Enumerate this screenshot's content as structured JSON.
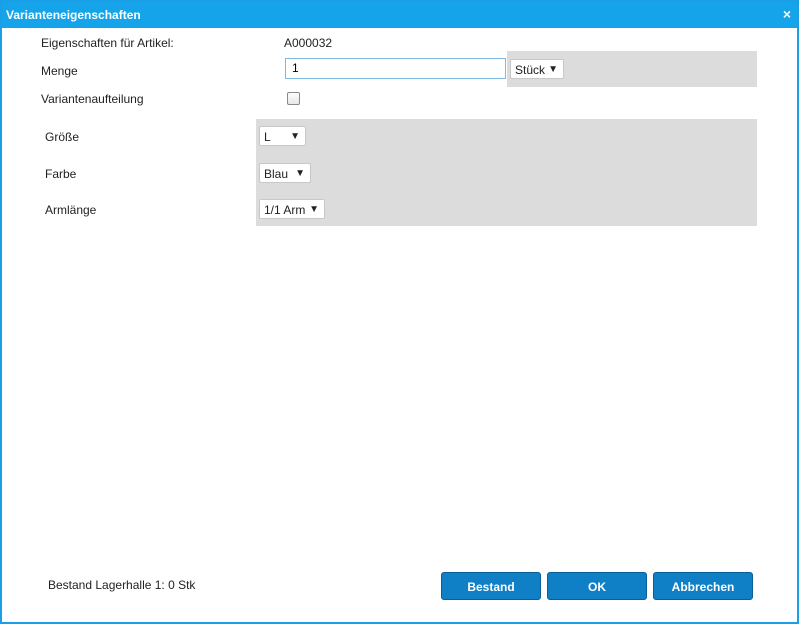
{
  "window": {
    "title": "Varianteneigenschaften",
    "close_symbol": "×"
  },
  "article": {
    "label": "Eigenschaften für Artikel:",
    "value": "A000032"
  },
  "quantity": {
    "label": "Menge",
    "value": "1",
    "unit_selected": "Stück"
  },
  "variant_split": {
    "label": "Variantenaufteilung",
    "checked": false
  },
  "attributes": [
    {
      "label": "Größe",
      "selected": "L"
    },
    {
      "label": "Farbe",
      "selected": "Blau"
    },
    {
      "label": "Armlänge",
      "selected": "1/1 Arm"
    }
  ],
  "footer": {
    "stock_text": "Bestand Lagerhalle 1: 0 Stk",
    "stock_button": "Bestand",
    "ok_button": "OK",
    "cancel_button": "Abbrechen"
  },
  "dropdown_arrow": "▼",
  "colors": {
    "titlebar": "#15a4ea",
    "button": "#0f7fc6",
    "panel": "#dcdcdc"
  }
}
